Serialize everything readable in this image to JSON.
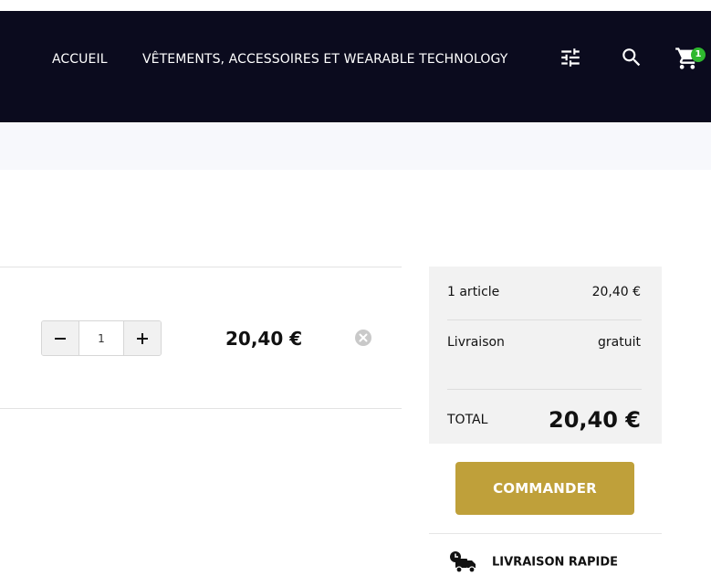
{
  "nav": {
    "home_label": "ACCUEIL",
    "category_label": "VÊTEMENTS, ACCESSOIRES ET WEARABLE TECHNOLOGY",
    "icons": [
      "filter-sliders-icon",
      "search-icon",
      "cart-icon"
    ],
    "cart_count": "1"
  },
  "cart_item": {
    "quantity": "1",
    "price": "20,40 €"
  },
  "summary": {
    "items_label": "1 article",
    "items_value": "20,40 €",
    "shipping_label": "Livraison",
    "shipping_value": "gratuit",
    "total_label": "TOTAL",
    "total_value": "20,40 €"
  },
  "checkout": {
    "order_button": "COMMANDER",
    "delivery_label": "LIVRAISON RAPIDE"
  },
  "colors": {
    "nav_bg": "#0b0b1e",
    "accent_gold": "#bfa03a",
    "badge_green": "#2eb82e",
    "summary_bg": "#f2f2f2"
  }
}
